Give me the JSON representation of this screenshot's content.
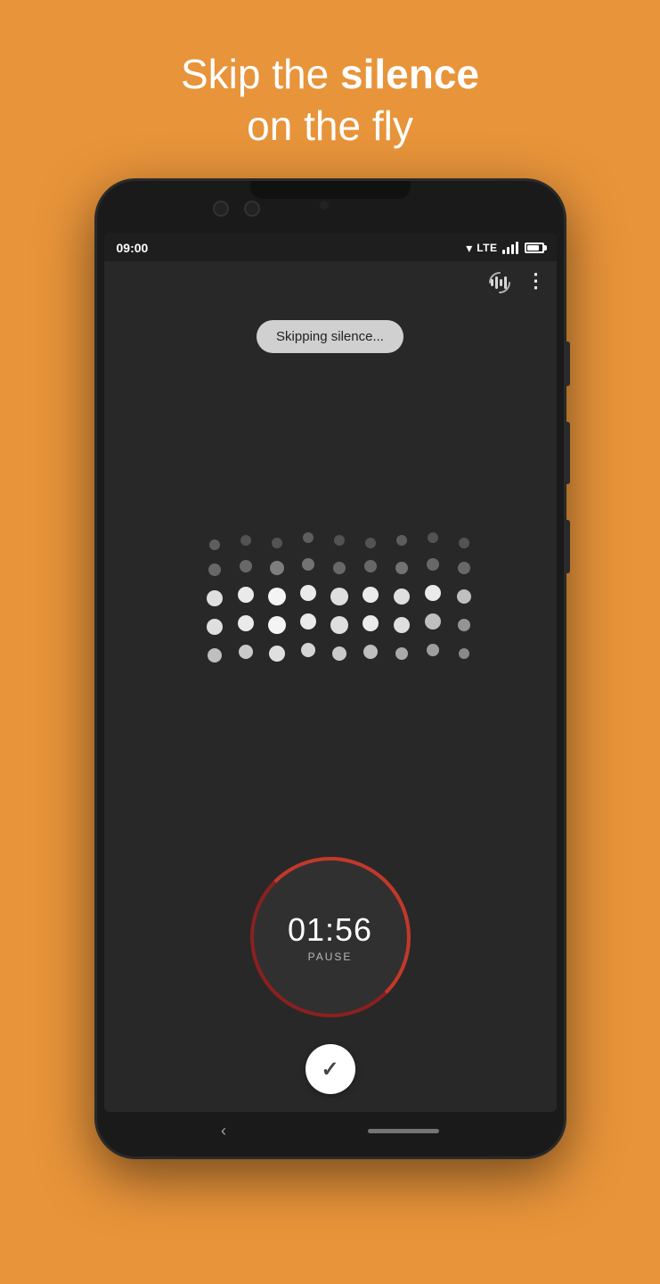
{
  "background_color": "#E8943A",
  "headline": {
    "line1": "Skip the ",
    "line1_bold": "silence",
    "line2": "on the fly"
  },
  "status_bar": {
    "time": "09:00",
    "lte": "LTE"
  },
  "app": {
    "skipping_badge": "Skipping silence...",
    "timer": "01:56",
    "pause_label": "PAUSE",
    "toolbar_more": "⋮"
  },
  "nav": {
    "back": "‹"
  }
}
